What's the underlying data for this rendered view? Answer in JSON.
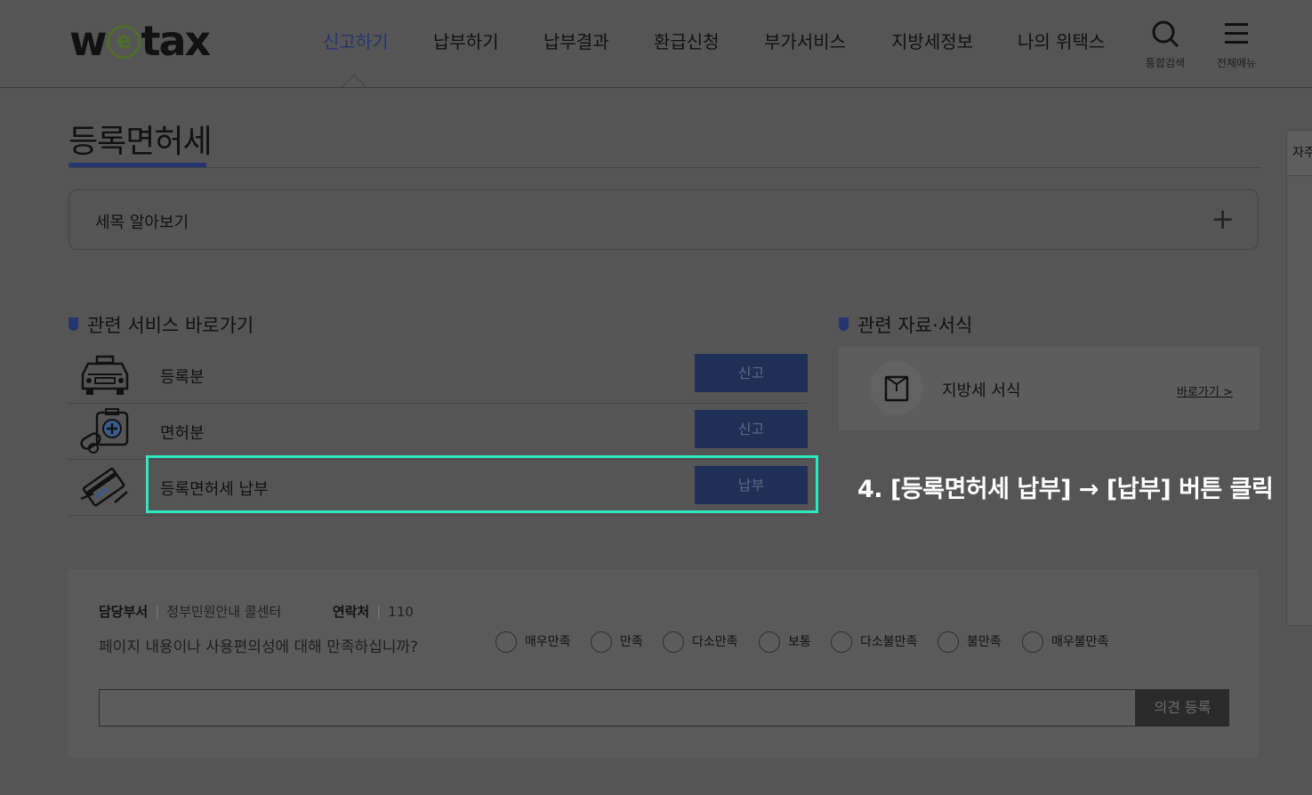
{
  "header": {
    "logo": {
      "pre": "w",
      "mid": "e",
      "post": "tax"
    },
    "nav": [
      {
        "label": "신고하기",
        "active": true
      },
      {
        "label": "납부하기"
      },
      {
        "label": "납부결과"
      },
      {
        "label": "환급신청"
      },
      {
        "label": "부가서비스"
      },
      {
        "label": "지방세정보"
      },
      {
        "label": "나의 위택스"
      }
    ],
    "search_label": "통합검색",
    "menu_label": "전체메뉴"
  },
  "page": {
    "title": "등록면허세",
    "accordion": {
      "title": "세목 알아보기",
      "toggle": "+"
    },
    "right_tab": "자주"
  },
  "services": {
    "heading": "관련 서비스 바로가기",
    "items": [
      {
        "name": "등록분",
        "button": "신고",
        "icon": "car-icon"
      },
      {
        "name": "면허분",
        "button": "신고",
        "icon": "medical-kit-icon"
      },
      {
        "name": "등록면허세 납부",
        "button": "납부",
        "icon": "card-payment-icon"
      }
    ]
  },
  "resources": {
    "heading": "관련 자료·서식",
    "item": {
      "name": "지방세 서식",
      "link": "바로가기 >",
      "icon": "document-icon"
    }
  },
  "callout": "4. [등록면허세 납부] → [납부] 버튼 클릭",
  "survey": {
    "dept_label": "담당부서",
    "dept_value": "정부민원안내 콜센터",
    "contact_label": "연락처",
    "contact_value": "110",
    "question": "페이지 내용이나 사용편의성에 대해 만족하십니까?",
    "options": [
      "매우만족",
      "만족",
      "다소만족",
      "보통",
      "다소불만족",
      "불만족",
      "매우불만족"
    ],
    "input_placeholder": "",
    "submit": "의견 등록"
  },
  "colors": {
    "accent": "#25356d",
    "button": "#1f2f55",
    "highlight": "#2ee8bf",
    "overlay_bg": "#555555"
  }
}
